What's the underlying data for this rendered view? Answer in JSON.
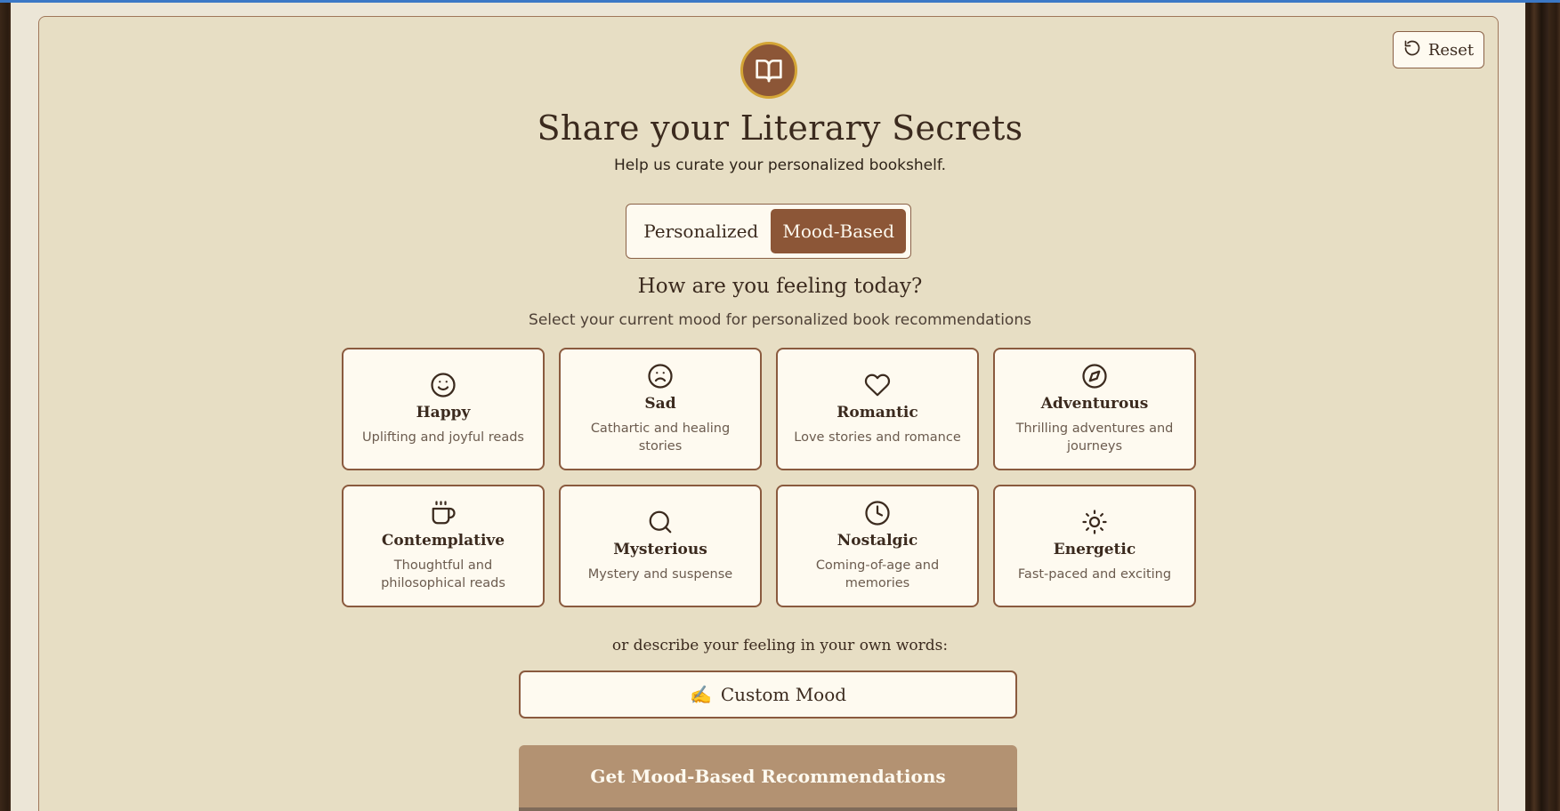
{
  "header": {
    "reset_label": "Reset",
    "title": "Share your Literary Secrets",
    "subtitle": "Help us curate your personalized bookshelf."
  },
  "mode_toggle": {
    "options": [
      {
        "label": "Personalized",
        "active": false
      },
      {
        "label": "Mood-Based",
        "active": true
      }
    ]
  },
  "mood_section": {
    "title": "How are you feeling today?",
    "subtitle": "Select your current mood for personalized book recommendations",
    "moods": [
      {
        "name": "Happy",
        "description": "Uplifting and joyful reads",
        "icon": "smile-icon"
      },
      {
        "name": "Sad",
        "description": "Cathartic and healing stories",
        "icon": "frown-icon"
      },
      {
        "name": "Romantic",
        "description": "Love stories and romance",
        "icon": "heart-icon"
      },
      {
        "name": "Adventurous",
        "description": "Thrilling adventures and journeys",
        "icon": "compass-icon"
      },
      {
        "name": "Contemplative",
        "description": "Thoughtful and philosophical reads",
        "icon": "coffee-icon"
      },
      {
        "name": "Mysterious",
        "description": "Mystery and suspense",
        "icon": "search-icon"
      },
      {
        "name": "Nostalgic",
        "description": "Coming-of-age and memories",
        "icon": "clock-icon"
      },
      {
        "name": "Energetic",
        "description": "Fast-paced and exciting",
        "icon": "sun-icon"
      }
    ]
  },
  "custom": {
    "prompt": "or describe your feeling in your own words:",
    "button_emoji": "✍️",
    "button_label": "Custom Mood"
  },
  "cta": {
    "label": "Get Mood-Based Recommendations"
  },
  "colors": {
    "accent": "#8c5637",
    "card_bg": "#e7dec4",
    "tile_bg": "#fefaf0",
    "cta_bg": "#b39272",
    "logo_ring": "#d4a536"
  }
}
